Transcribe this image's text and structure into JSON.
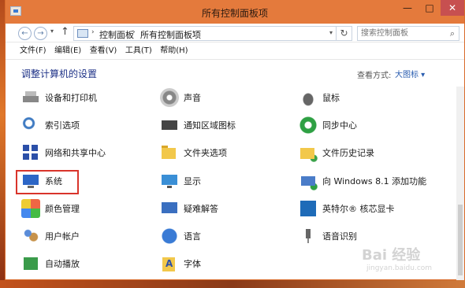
{
  "window": {
    "title": "所有控制面板项",
    "minimize": "—",
    "maximize": "□",
    "close": "✕"
  },
  "nav": {
    "back": "←",
    "forward": "→",
    "recent": "▾",
    "up": "↑",
    "breadcrumb": [
      "控制面板",
      "所有控制面板项"
    ],
    "separator": "›",
    "dropdown": "▾",
    "refresh": "↻",
    "search_placeholder": "搜索控制面板",
    "search_icon": "⌕"
  },
  "menu": [
    "文件(F)",
    "编辑(E)",
    "查看(V)",
    "工具(T)",
    "帮助(H)"
  ],
  "header": {
    "title": "调整计算机的设置",
    "view_label": "查看方式:",
    "view_value": "大图标 ▾"
  },
  "items": [
    {
      "label": "设备和打印机",
      "icon": "printer-icon"
    },
    {
      "label": "声音",
      "icon": "sound-icon"
    },
    {
      "label": "鼠标",
      "icon": "mouse-icon"
    },
    {
      "label": "索引选项",
      "icon": "index-icon"
    },
    {
      "label": "通知区域图标",
      "icon": "notification-icon"
    },
    {
      "label": "同步中心",
      "icon": "sync-icon"
    },
    {
      "label": "网络和共享中心",
      "icon": "network-icon"
    },
    {
      "label": "文件夹选项",
      "icon": "folder-icon"
    },
    {
      "label": "文件历史记录",
      "icon": "file-history-icon"
    },
    {
      "label": "系统",
      "icon": "system-icon"
    },
    {
      "label": "显示",
      "icon": "display-icon"
    },
    {
      "label": "向 Windows 8.1 添加功能",
      "icon": "add-features-icon"
    },
    {
      "label": "颜色管理",
      "icon": "color-management-icon"
    },
    {
      "label": "疑难解答",
      "icon": "troubleshooting-icon"
    },
    {
      "label": "英特尔® 核芯显卡",
      "icon": "intel-graphics-icon"
    },
    {
      "label": "用户帐户",
      "icon": "user-accounts-icon"
    },
    {
      "label": "语言",
      "icon": "language-icon"
    },
    {
      "label": "语音识别",
      "icon": "speech-recognition-icon"
    },
    {
      "label": "自动播放",
      "icon": "autoplay-icon"
    },
    {
      "label": "字体",
      "icon": "fonts-icon"
    }
  ],
  "watermark": {
    "logo": "Bai 经验",
    "sub": "jingyan.baidu.com"
  }
}
